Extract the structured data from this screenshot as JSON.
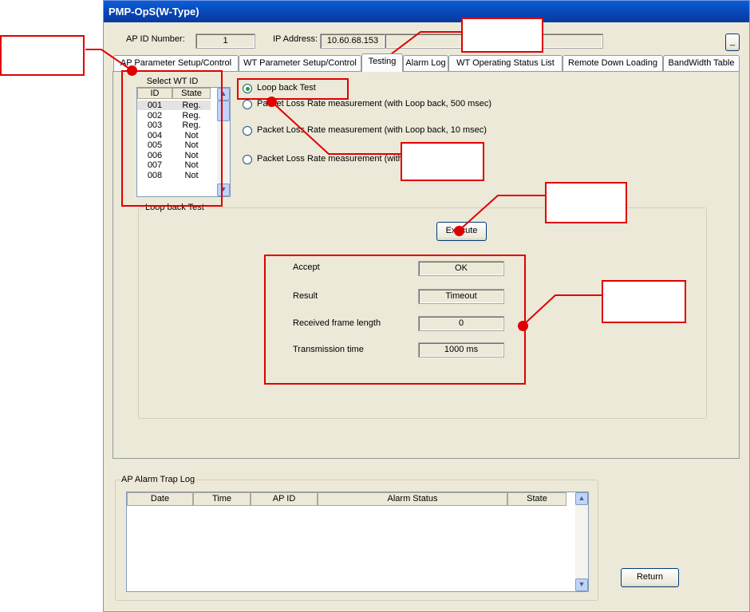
{
  "window": {
    "title": "PMP-OpS(W-Type)",
    "minimize_label": "_"
  },
  "header": {
    "ap_id_label": "AP ID Number:",
    "ap_id_value": "1",
    "ip_label": "IP Address:",
    "ip_value": "10.60.68.153"
  },
  "tabs": [
    {
      "label": "AP Parameter Setup/Control"
    },
    {
      "label": "WT Parameter Setup/Control"
    },
    {
      "label": "Testing"
    },
    {
      "label": "Alarm Log"
    },
    {
      "label": "WT Operating Status List"
    },
    {
      "label": "Remote Down Loading"
    },
    {
      "label": "BandWidth Table"
    }
  ],
  "wt_list": {
    "title": "Select WT ID",
    "columns": [
      "ID",
      "State"
    ],
    "rows": [
      {
        "id": "001",
        "state": "Reg."
      },
      {
        "id": "002",
        "state": "Reg."
      },
      {
        "id": "003",
        "state": "Reg."
      },
      {
        "id": "004",
        "state": "Not"
      },
      {
        "id": "005",
        "state": "Not"
      },
      {
        "id": "006",
        "state": "Not"
      },
      {
        "id": "007",
        "state": "Not"
      },
      {
        "id": "008",
        "state": "Not"
      }
    ]
  },
  "test_options": [
    {
      "label": "Loop back Test",
      "selected": true
    },
    {
      "label": "Packet Loss Rate measurement (with Loop back, 500 msec)",
      "selected": false
    },
    {
      "label": "Packet Loss Rate measurement (with Loop back, 10 msec)",
      "selected": false
    },
    {
      "label": "Packet Loss Rate measurement (with",
      "selected": false
    }
  ],
  "loopback": {
    "group_label": "Loop back Test",
    "execute_label": "Execute",
    "accept_label": "Accept",
    "accept_value": "OK",
    "result_label": "Result",
    "result_value": "Timeout",
    "frame_label": "Received frame length",
    "frame_value": "0",
    "time_label": "Transmission time",
    "time_value": "1000 ms"
  },
  "alarm_log": {
    "group_label": "AP Alarm Trap Log",
    "columns": [
      "Date",
      "Time",
      "AP ID",
      "Alarm Status",
      "State"
    ]
  },
  "footer": {
    "return_label": "Return"
  },
  "icons": {
    "scroll_up": "scroll-up-arrow-icon",
    "scroll_down": "scroll-down-arrow-icon"
  },
  "colors": {
    "annotation_red": "#e00000",
    "titlebar_blue": "#0a4cc8",
    "window_face": "#ece9d8",
    "group_label_blue": "#0046d5"
  }
}
